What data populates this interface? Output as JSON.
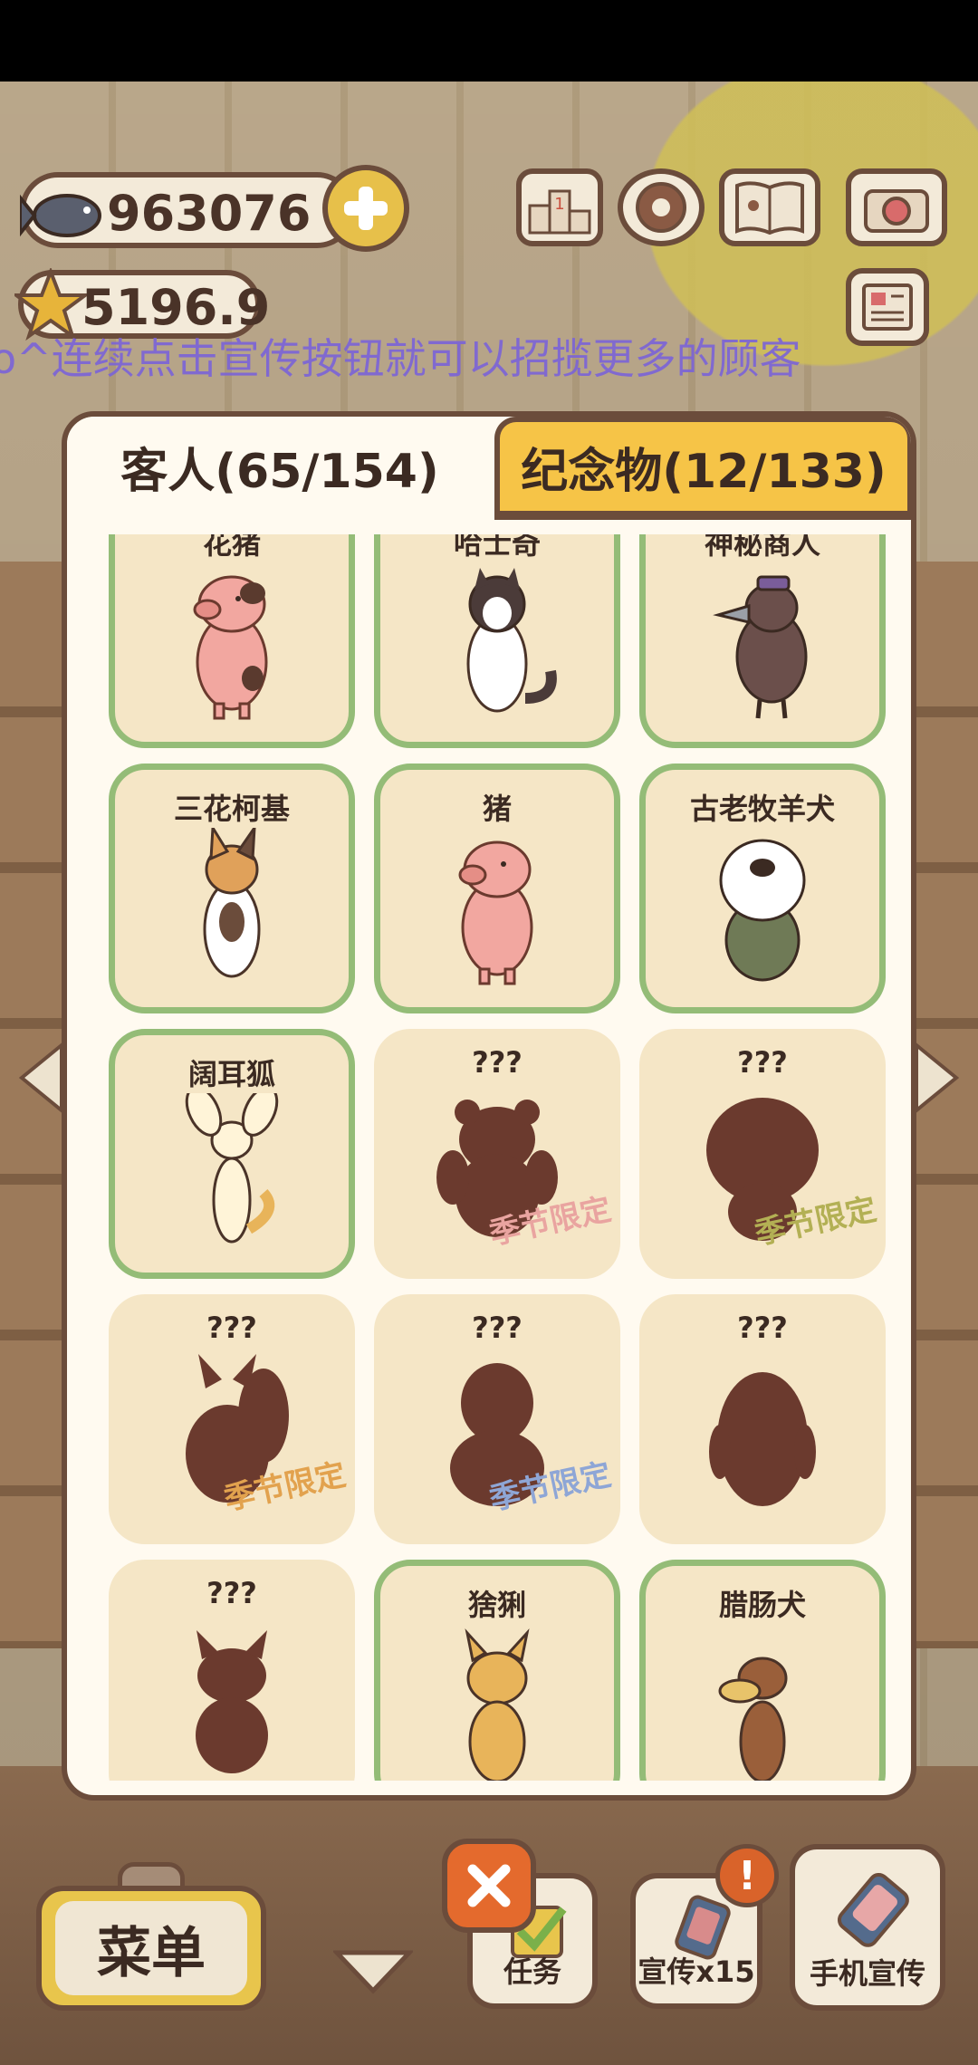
{
  "hud": {
    "fish_count": "963076",
    "star_rating": "5196.9",
    "marquee_text": "o^连续点击宣传按钮就可以招揽更多的顾客"
  },
  "tabs": [
    {
      "label": "客人(65/154)",
      "active": true
    },
    {
      "label": "纪念物(12/133)",
      "active": false
    }
  ],
  "guests": [
    {
      "name": "花猪",
      "unlocked": true,
      "art": "spotted-pig-icon"
    },
    {
      "name": "哈士奇",
      "unlocked": true,
      "art": "husky-icon"
    },
    {
      "name": "神秘商人",
      "unlocked": true,
      "art": "crow-merchant-icon"
    },
    {
      "name": "三花柯基",
      "unlocked": true,
      "art": "tricolor-corgi-icon"
    },
    {
      "name": "猪",
      "unlocked": true,
      "art": "pig-icon"
    },
    {
      "name": "古老牧羊犬",
      "unlocked": true,
      "art": "old-english-sheepdog-icon"
    },
    {
      "name": "阔耳狐",
      "unlocked": true,
      "art": "fennec-fox-icon"
    },
    {
      "name": "???",
      "unlocked": false,
      "seasonal": "季节限定",
      "seasonal_color": "#e9a4a0",
      "art": "silhouette-bear-icon"
    },
    {
      "name": "???",
      "unlocked": false,
      "seasonal": "季节限定",
      "seasonal_color": "#b3b054",
      "art": "silhouette-round-icon"
    },
    {
      "name": "???",
      "unlocked": false,
      "seasonal": "季节限定",
      "seasonal_color": "#e2a24e",
      "art": "silhouette-squirrel-icon"
    },
    {
      "name": "???",
      "unlocked": false,
      "seasonal": "季节限定",
      "seasonal_color": "#8ea6d6",
      "art": "silhouette-fluffy-icon"
    },
    {
      "name": "???",
      "unlocked": false,
      "art": "silhouette-penguin-icon"
    },
    {
      "name": "???",
      "unlocked": false,
      "art": "silhouette-cat-icon"
    },
    {
      "name": "猞猁",
      "unlocked": true,
      "art": "lynx-icon"
    },
    {
      "name": "腊肠犬",
      "unlocked": true,
      "art": "dachshund-icon"
    }
  ],
  "bottom_bar": {
    "menu_label": "菜单",
    "tasks_label": "任务",
    "promote_label": "宣传x15",
    "phone_promote_label": "手机宣传"
  },
  "colors": {
    "accent_yellow": "#f6c447",
    "outline_brown": "#6b4c3b",
    "unlocked_border": "#94bc77",
    "card_bg": "#f5e6c6",
    "silhouette": "#6b3a2e"
  }
}
